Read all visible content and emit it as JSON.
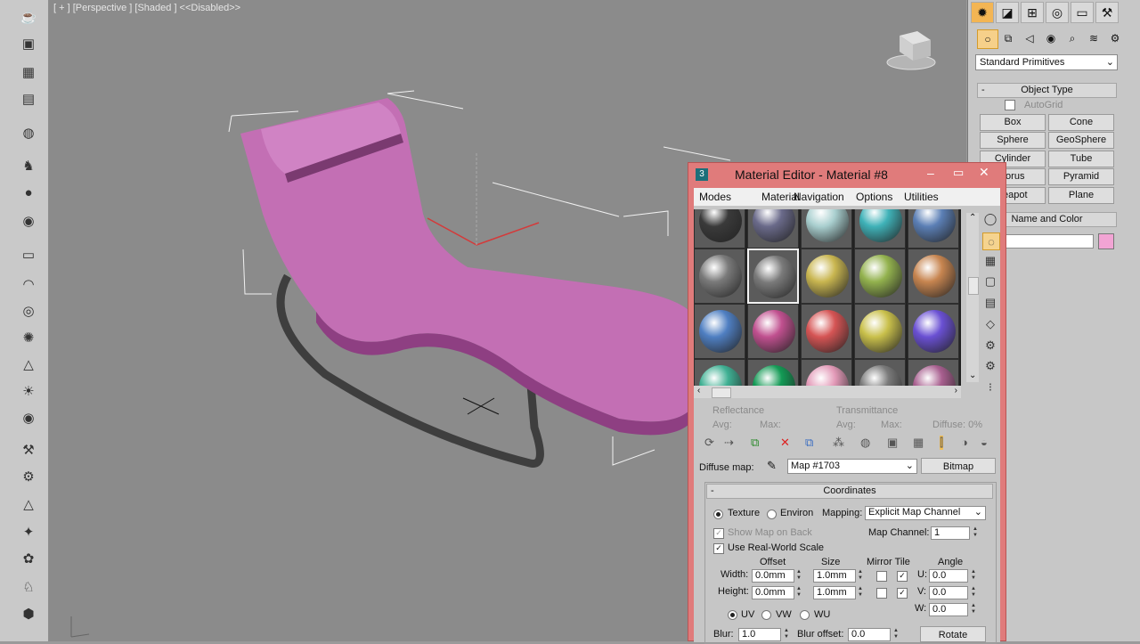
{
  "viewport": {
    "label": "[ + ] [Perspective ] [Shaded ]  <<Disabled>>"
  },
  "left_toolbar": {
    "icons": [
      "teapot-icon",
      "render-frame-icon",
      "calculator-icon",
      "grid-icon",
      "material-icon",
      "walk-icon",
      "sphere-icon",
      "camera-icon",
      "plane-icon",
      "cone-shape-icon",
      "torus-icon",
      "hair-icon",
      "spot-icon",
      "sun-icon",
      "sky-icon",
      "brush-icon",
      "bone-icon",
      "pyramid-icon",
      "geosphere-icon",
      "plant-icon",
      "animal-icon",
      "rock-icon"
    ]
  },
  "command_panel": {
    "dropdown": "Standard Primitives",
    "object_type": {
      "header": "Object Type",
      "autogrid": "AutoGrid",
      "buttons": [
        "Box",
        "Cone",
        "Sphere",
        "GeoSphere",
        "Cylinder",
        "Tube",
        "Torus",
        "Pyramid",
        "Teapot",
        "Plane"
      ]
    },
    "name_and_color": {
      "header": "Name and Color",
      "name_value": "",
      "color": "#f2a4d4"
    }
  },
  "material_editor": {
    "title": "Material Editor - Material #8",
    "menu": [
      "Modes",
      "Material",
      "Navigation",
      "Options",
      "Utilities"
    ],
    "slot_colors": [
      [
        "#3a3a3a",
        "#6a6a8a",
        "#a9cfcf",
        "#3fb2b8",
        "#5b7fb5"
      ],
      [
        "#7a7a7a",
        "#7a7a7a",
        "#c9b650",
        "#93b24e",
        "#c78550"
      ],
      [
        "#4f7fc2",
        "#c0508f",
        "#d55454",
        "#c9c04b",
        "#6a50d3"
      ],
      [
        "#3fb093",
        "#139a55",
        "#e39ab8",
        "#7a7a7a",
        "#a85f8f"
      ]
    ],
    "reflectance": {
      "label": "Reflectance",
      "avg": "Avg:",
      "max": "Max:"
    },
    "transmittance": {
      "label": "Transmittance",
      "avg": "Avg:",
      "max": "Max:",
      "diffuse": "Diffuse: 0%"
    },
    "diffuse_map": {
      "label": "Diffuse map:",
      "map_name": "Map #1703",
      "type_button": "Bitmap"
    },
    "coordinates": {
      "header": "Coordinates",
      "texture": "Texture",
      "environ": "Environ",
      "mapping_label": "Mapping:",
      "mapping_value": "Explicit Map Channel",
      "show_map_on_back": "Show Map on Back",
      "map_channel_label": "Map Channel:",
      "map_channel_value": "1",
      "use_real_world_scale": "Use Real-World Scale",
      "offset": "Offset",
      "size": "Size",
      "mirror_tile": "Mirror Tile",
      "angle": "Angle",
      "width_label": "Width:",
      "height_label": "Height:",
      "width_offset": "0.0mm",
      "height_offset": "0.0mm",
      "width_size": "1.0mm",
      "height_size": "1.0mm",
      "u_label": "U:",
      "v_label": "V:",
      "w_label": "W:",
      "u_angle": "0.0",
      "v_angle": "0.0",
      "w_angle": "0.0",
      "uv": "UV",
      "vw": "VW",
      "wu": "WU",
      "blur_label": "Blur:",
      "blur_value": "1.0",
      "blur_offset_label": "Blur offset:",
      "blur_offset_value": "0.0",
      "rotate_button": "Rotate"
    }
  }
}
